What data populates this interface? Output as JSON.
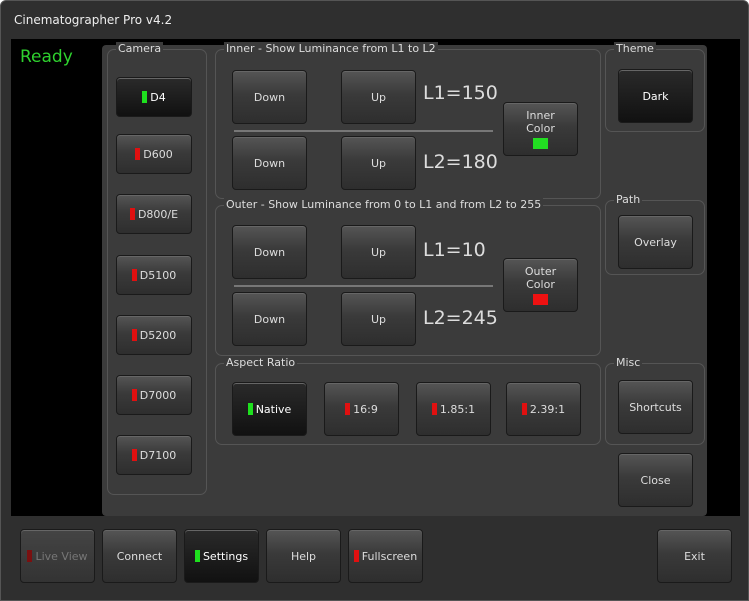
{
  "window": {
    "title": "Cinematographer Pro v4.2"
  },
  "status": "Ready",
  "camera": {
    "label": "Camera",
    "items": [
      {
        "label": "D4",
        "led": "green"
      },
      {
        "label": "D600",
        "led": "red"
      },
      {
        "label": "D800/E",
        "led": "red"
      },
      {
        "label": "D5100",
        "led": "red"
      },
      {
        "label": "D5200",
        "led": "red"
      },
      {
        "label": "D7000",
        "led": "red"
      },
      {
        "label": "D7100",
        "led": "red"
      }
    ]
  },
  "inner": {
    "label": "Inner - Show Luminance from L1 to L2",
    "down": "Down",
    "up": "Up",
    "l1": "L1=150",
    "l2": "L2=180",
    "color_label": "Inner Color",
    "color": "#22dd22"
  },
  "outer": {
    "label": "Outer - Show Luminance from 0 to L1 and from L2 to 255",
    "down": "Down",
    "up": "Up",
    "l1": "L1=10",
    "l2": "L2=245",
    "color_label": "Outer Color",
    "color": "#ee1111"
  },
  "aspect": {
    "label": "Aspect Ratio",
    "items": [
      {
        "label": "Native",
        "led": "green"
      },
      {
        "label": "16:9",
        "led": "red"
      },
      {
        "label": "1.85:1",
        "led": "red"
      },
      {
        "label": "2.39:1",
        "led": "red"
      }
    ]
  },
  "theme": {
    "label": "Theme",
    "button": "Dark"
  },
  "path": {
    "label": "Path",
    "button": "Overlay"
  },
  "misc": {
    "label": "Misc",
    "button": "Shortcuts"
  },
  "close": "Close",
  "bottom": {
    "live_view": "Live View",
    "connect": "Connect",
    "settings": "Settings",
    "help": "Help",
    "fullscreen": "Fullscreen",
    "exit": "Exit"
  }
}
